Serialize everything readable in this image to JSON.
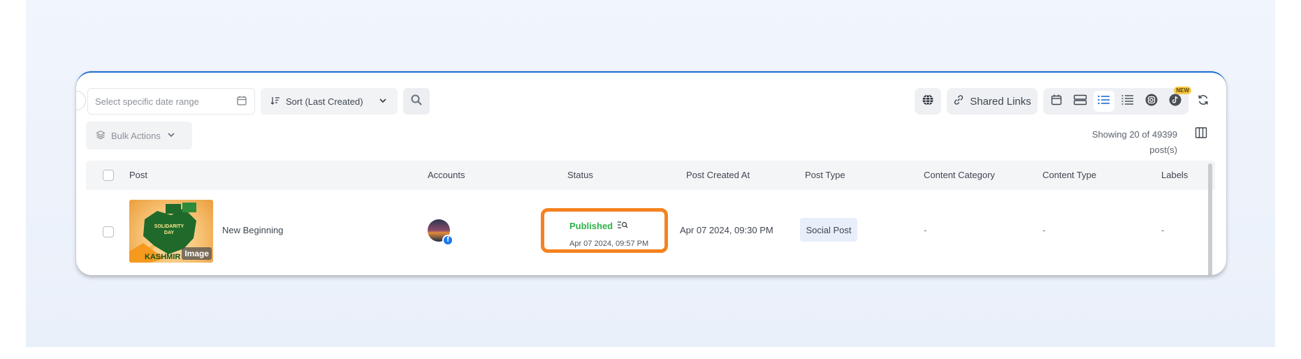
{
  "toolbar": {
    "date_placeholder": "Select specific date range",
    "sort_label": "Sort (Last Created)",
    "shared_links_label": "Shared Links",
    "new_badge": "NEW",
    "bulk_actions_label": "Bulk Actions",
    "showing_text": "Showing 20 of 49399 post(s)"
  },
  "icons": {
    "calendar": "calendar-icon",
    "sort": "sort-icon",
    "chevron": "chevron-down-icon",
    "search": "search-icon",
    "globe": "globe-icon",
    "link": "link-icon",
    "views": [
      "calendar-view-icon",
      "card-view-icon",
      "list-view-icon",
      "compact-list-view-icon",
      "instagram-grid-icon",
      "tiktok-grid-icon"
    ],
    "refresh": "refresh-icon",
    "layers": "layers-icon",
    "columns": "columns-icon"
  },
  "table": {
    "headers": [
      "Post",
      "Accounts",
      "Status",
      "Post Created At",
      "Post Type",
      "Content Category",
      "Content Type",
      "Labels"
    ],
    "rows": [
      {
        "thumbnail_tag": "Image",
        "thumbnail_text": "SOLIDARITY DAY",
        "thumbnail_text2": "KASHMIR",
        "title": "New Beginning",
        "account_network": "f",
        "status": "Published",
        "status_date": "Apr 07 2024, 09:57 PM",
        "created_at": "Apr 07 2024, 09:30 PM",
        "post_type": "Social Post",
        "content_category": "-",
        "content_type": "-",
        "labels": "-"
      }
    ]
  },
  "colors": {
    "accent": "#1f6ed4",
    "published": "#2fb14a",
    "highlight": "#f5821f",
    "post_type_bg": "#e8eefa"
  }
}
